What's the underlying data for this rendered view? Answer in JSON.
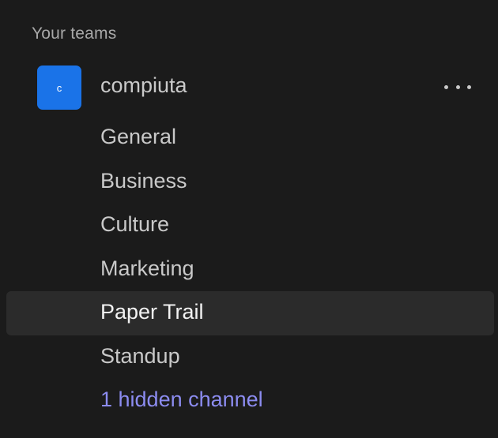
{
  "sidebar": {
    "section_title": "Your teams",
    "team": {
      "avatar_letter": "c",
      "name": "compiuta",
      "menu_icon": "more-horizontal-icon"
    },
    "channels": [
      {
        "label": "General",
        "active": false
      },
      {
        "label": "Business",
        "active": false
      },
      {
        "label": "Culture",
        "active": false
      },
      {
        "label": "Marketing",
        "active": false
      },
      {
        "label": "Paper Trail",
        "active": true
      },
      {
        "label": "Standup",
        "active": false
      }
    ],
    "hidden_channels_link": "1 hidden channel"
  },
  "colors": {
    "background": "#1b1b1b",
    "active_row": "#2b2b2b",
    "avatar": "#1a73e8",
    "link": "#8c8cf0"
  }
}
